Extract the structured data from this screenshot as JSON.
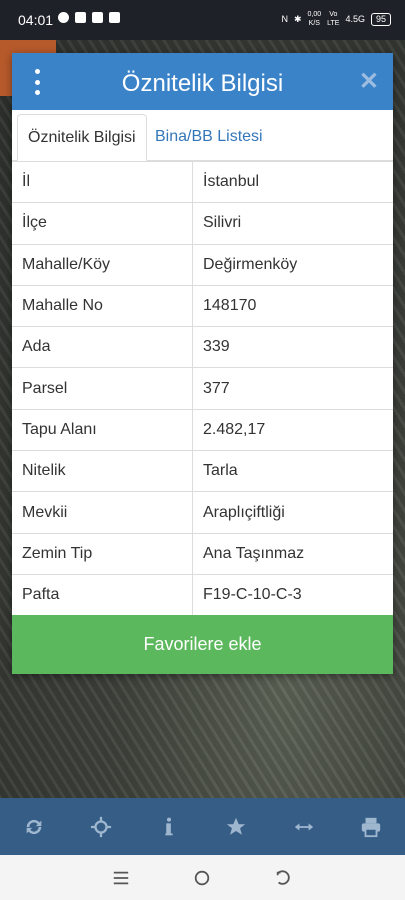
{
  "status_bar": {
    "time": "04:01",
    "net_speed": "0,00\nK/S",
    "carrier": "Vo\nLTE",
    "signal": "4.5G",
    "battery": "95"
  },
  "modal": {
    "title": "Öznitelik Bilgisi",
    "tabs": [
      {
        "label": "Öznitelik Bilgisi",
        "active": true
      },
      {
        "label": "Bina/BB Listesi",
        "active": false
      }
    ],
    "rows": [
      {
        "key": "İl",
        "value": "İstanbul"
      },
      {
        "key": "İlçe",
        "value": "Silivri"
      },
      {
        "key": "Mahalle/Köy",
        "value": "Değirmenköy"
      },
      {
        "key": "Mahalle No",
        "value": "148170"
      },
      {
        "key": "Ada",
        "value": "339"
      },
      {
        "key": "Parsel",
        "value": "377"
      },
      {
        "key": "Tapu Alanı",
        "value": "2.482,17"
      },
      {
        "key": "Nitelik",
        "value": "Tarla"
      },
      {
        "key": "Mevkii",
        "value": "Araplıçiftliği"
      },
      {
        "key": "Zemin Tip",
        "value": "Ana Taşınmaz"
      },
      {
        "key": "Pafta",
        "value": "F19-C-10-C-3"
      }
    ],
    "favorite_button": "Favorilere ekle"
  },
  "colors": {
    "header_blue": "#3b83c9",
    "green_button": "#5cb85c",
    "toolbar_blue": "#355d86"
  },
  "toolbar_icons": [
    "refresh-icon",
    "crosshair-icon",
    "info-icon",
    "star-icon",
    "measure-icon",
    "print-icon"
  ]
}
